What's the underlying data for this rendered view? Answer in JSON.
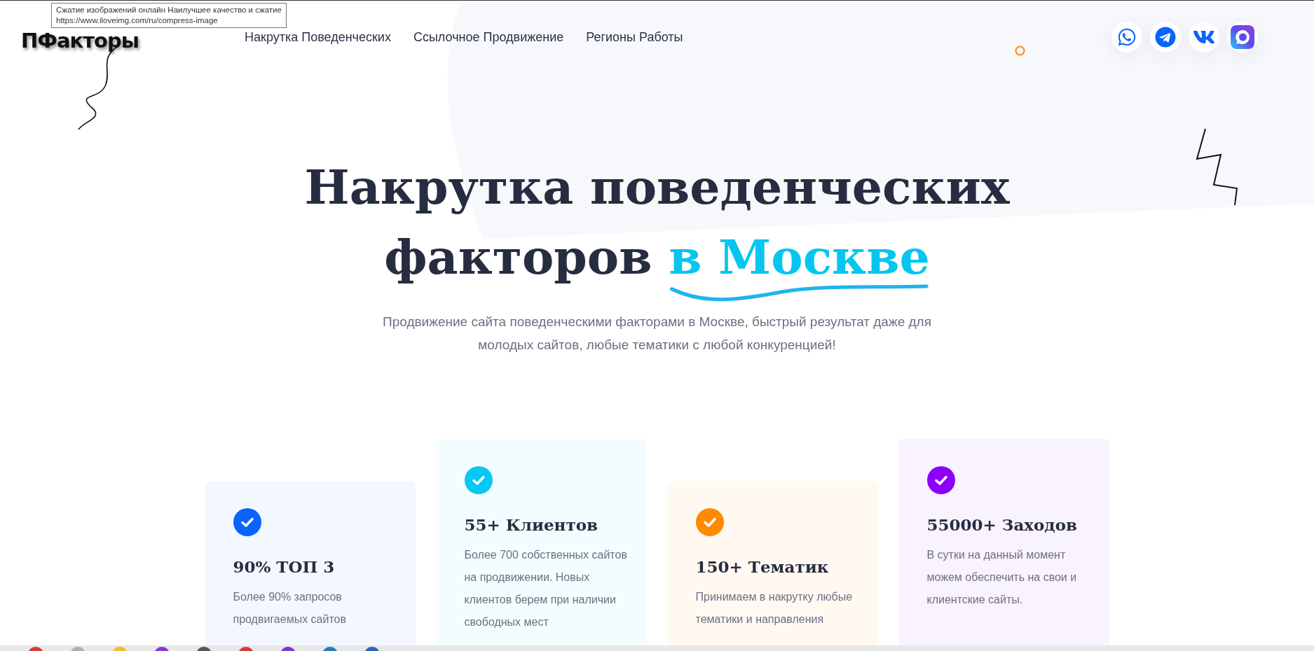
{
  "tooltip": {
    "lines": [
      "Сжатие изображений онлайн Наилучшее качество и сжатие",
      "https://www.iloveimg.com/ru/compress-image"
    ]
  },
  "logo": "ПФакторы",
  "nav": [
    {
      "label": "Накрутка Поведенческих"
    },
    {
      "label": "Ссылочное Продвижение"
    },
    {
      "label": "Регионы Работы"
    }
  ],
  "social": [
    {
      "kind": "whatsapp"
    },
    {
      "kind": "telegram"
    },
    {
      "kind": "vk"
    },
    {
      "kind": "chat"
    }
  ],
  "hero": {
    "title_line1": "Накрутка поведенческих",
    "title_line2": "факторов",
    "highlight": "в Москве",
    "subtitle": "Продвижение сайта поведенческими факторами в Москве, быстрый результат даже для молодых сайтов, любые тематики с любой конкуренцией!"
  },
  "cards": [
    {
      "color": "#0a64fa",
      "title": "90% ТОП 3",
      "text": "Более 90% запросов продвигаемых сайтов"
    },
    {
      "color": "#06c8f3",
      "title": "55+ Клиентов",
      "text": "Более 700 собственных сайтов на продвижении. Новых клиентов берем при наличии свободных мест"
    },
    {
      "color": "#ff8a00",
      "title": "150+ Тематик",
      "text": "Принимаем в накрутку любые тематики и направления"
    },
    {
      "color": "#8c00fa",
      "title": "55000+ Заходов",
      "text": "В сутки на данный момент можем обеспечить на свои и клиентские сайты."
    }
  ],
  "taskbar": {
    "apps": [
      {
        "color": "#d63a3a"
      },
      {
        "color": "#b0b0b0"
      },
      {
        "color": "#f0c020"
      },
      {
        "color": "#8a3ad6"
      },
      {
        "color": "#555555"
      },
      {
        "color": "#d63a3a"
      },
      {
        "color": "#7a3ad6"
      },
      {
        "color": "#2a7ab0"
      },
      {
        "color": "#3060c0"
      }
    ]
  }
}
